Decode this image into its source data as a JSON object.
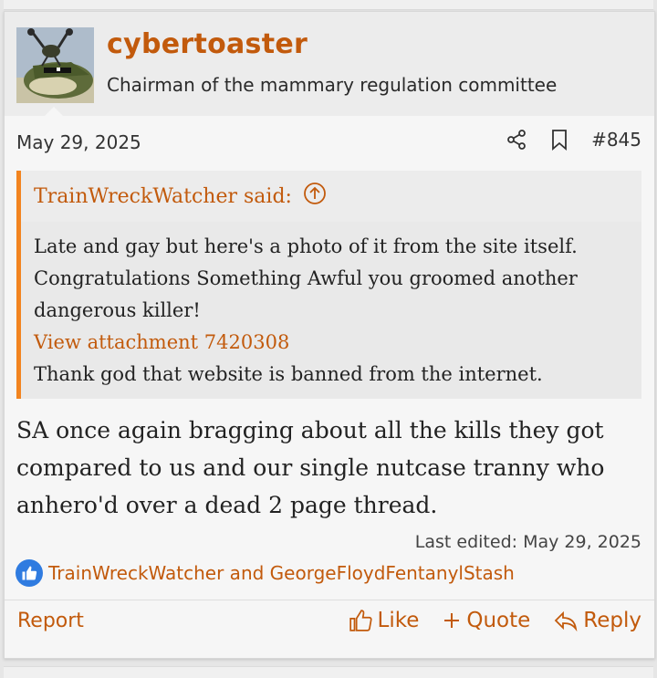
{
  "post": {
    "username": "cybertoaster",
    "user_title": "Chairman of the mammary regulation committee",
    "date": "May 29, 2025",
    "post_number": "#845",
    "quote": {
      "author_said": "TrainWreckWatcher said:",
      "line1": "Late and gay but here's a photo of it from the site itself.",
      "line2": "Congratulations Something Awful you groomed another dangerous killer!",
      "attachment_link": "View attachment 7420308",
      "line3": "Thank god that website is banned from the internet."
    },
    "body": "SA once again bragging about all the kills they got compared to us and our single nutcase tranny who anhero'd over a dead 2 page thread.",
    "last_edited": "Last edited: May 29, 2025",
    "reactions_text": "TrainWreckWatcher and GeorgeFloydFentanylStash"
  },
  "footer": {
    "report": "Report",
    "like": "Like",
    "quote": "Quote",
    "reply": "Reply"
  },
  "colors": {
    "accent": "#c25a0c",
    "quote_bar": "#f2841f",
    "like_badge": "#2f7be0"
  },
  "icons": [
    "share-icon",
    "bookmark-icon",
    "arrow-up-circle-icon",
    "thumbs-up-icon",
    "plus-icon",
    "reply-icon"
  ]
}
